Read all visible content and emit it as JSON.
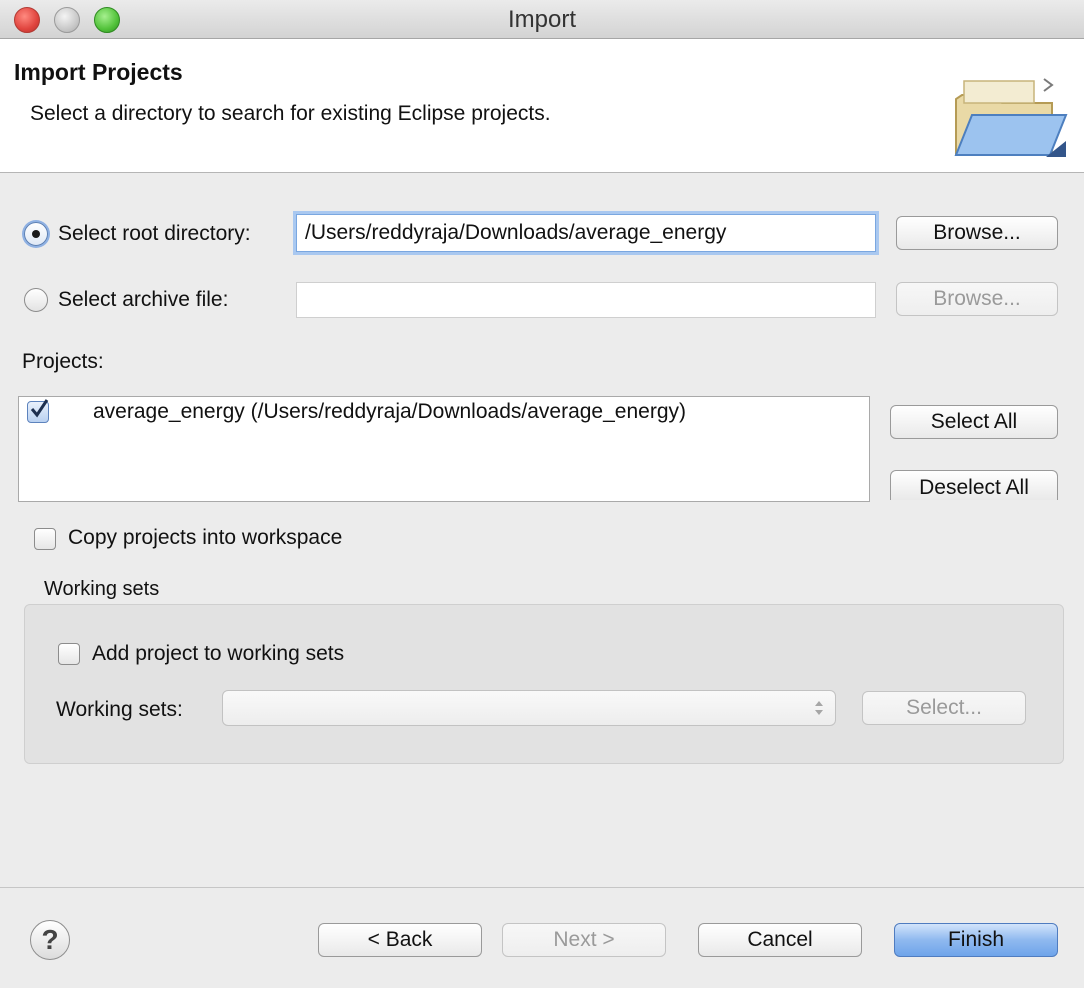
{
  "window": {
    "title": "Import"
  },
  "header": {
    "title": "Import Projects",
    "description": "Select a directory to search for existing Eclipse projects."
  },
  "source": {
    "root_label": "Select root directory:",
    "root_value": "/Users/reddyraja/Downloads/average_energy",
    "root_selected": true,
    "archive_label": "Select archive file:",
    "archive_value": "",
    "browse_label": "Browse...",
    "browse_archive_label": "Browse..."
  },
  "projects": {
    "label": "Projects:",
    "items": [
      {
        "label": "average_energy (/Users/reddyraja/Downloads/average_energy)",
        "checked": true
      }
    ],
    "select_all_label": "Select All",
    "deselect_all_label": "Deselect All"
  },
  "options": {
    "copy_label": "Copy projects into workspace",
    "copy_checked": false
  },
  "working_sets": {
    "group_label": "Working sets",
    "add_label": "Add project to working sets",
    "add_checked": false,
    "sets_label": "Working sets:",
    "select_label": "Select..."
  },
  "footer": {
    "back_label": "< Back",
    "next_label": "Next >",
    "cancel_label": "Cancel",
    "finish_label": "Finish",
    "help_symbol": "?"
  },
  "colors": {
    "accent": "#6ea4ea",
    "focus_ring": "#a9c8f0"
  }
}
